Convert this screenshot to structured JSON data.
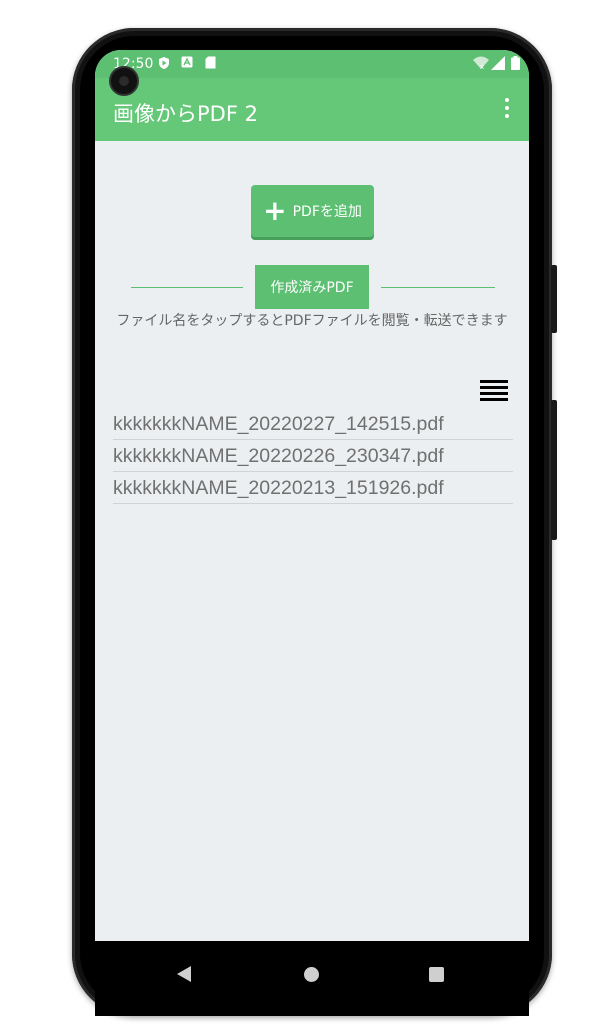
{
  "status_bar": {
    "time": "12:50",
    "icons": [
      "play-protect-icon",
      "a-icon",
      "sd-card-icon",
      "wifi-icon",
      "signal-icon",
      "battery-icon"
    ]
  },
  "app_bar": {
    "title": "画像からPDF 2",
    "menu_icon": "more-vert-icon"
  },
  "actions": {
    "add_pdf_label": "PDFを追加"
  },
  "section": {
    "title": "作成済みPDF",
    "hint": "ファイル名をタップするとPDFファイルを閲覧・転送できます"
  },
  "files": [
    "kkkkkkkNAME_20220227_142515.pdf",
    "kkkkkkkNAME_20220226_230347.pdf",
    "kkkkkkkNAME_20220213_151926.pdf"
  ],
  "colors": {
    "accent": "#65c878",
    "status_bar": "#5cbf72",
    "background": "#eceff1"
  }
}
